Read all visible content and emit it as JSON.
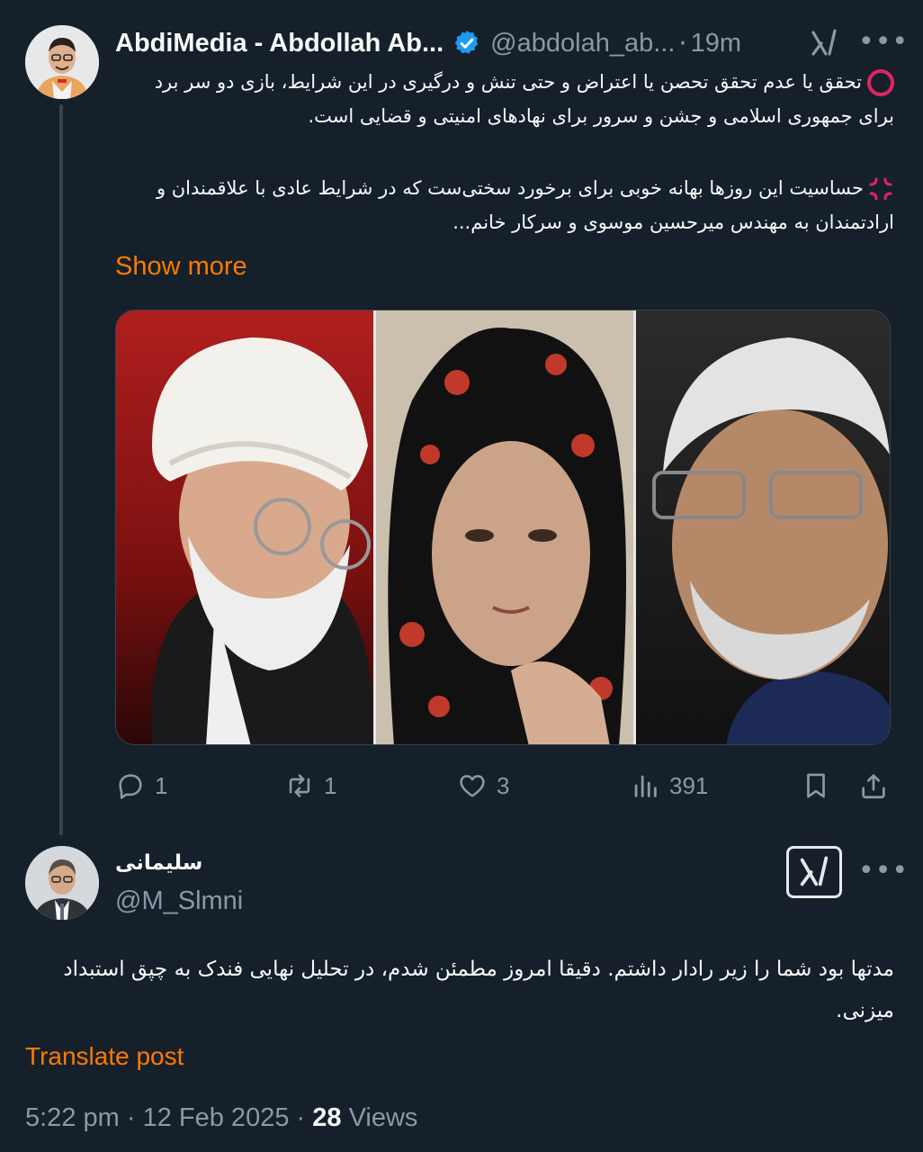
{
  "tweet": {
    "author_name": "AbdiMedia - Abdollah Ab...",
    "handle": "@abdolah_ab...",
    "separator": "·",
    "time": "19m",
    "paragraph1": "تحقق یا عدم تحقق تحصن یا اعتراض و حتی تنش و درگیری در این شرایط، بازی دو سر برد برای جمهوری اسلامی و جشن و سرور برای نهادهای امنیتی و قضایی است.",
    "paragraph2": "حساسیت این روزها بهانه خوبی برای برخورد سختی‌ست که در شرایط عادی با علاقمندان و ارادتمندان به مهندس میرحسین موسوی و سرکار خانم...",
    "show_more": "Show more",
    "replies": "1",
    "reposts": "1",
    "likes": "3",
    "views": "391",
    "verified_color": "#1d9bf0",
    "accent": "#ff7a00"
  },
  "reply": {
    "author_name": "سلیمانی",
    "handle": "@M_Slmni",
    "text": "مدتها بود شما را زیر رادار داشتم. دقیقا امروز مطمئن شدم، در تحلیل نهایی فندک به چپق استبداد میزنی.",
    "translate": "Translate post",
    "timestamp": "5:22 pm",
    "date": "12 Feb 2025",
    "views_count": "28",
    "views_label": "Views",
    "separator": "·"
  }
}
